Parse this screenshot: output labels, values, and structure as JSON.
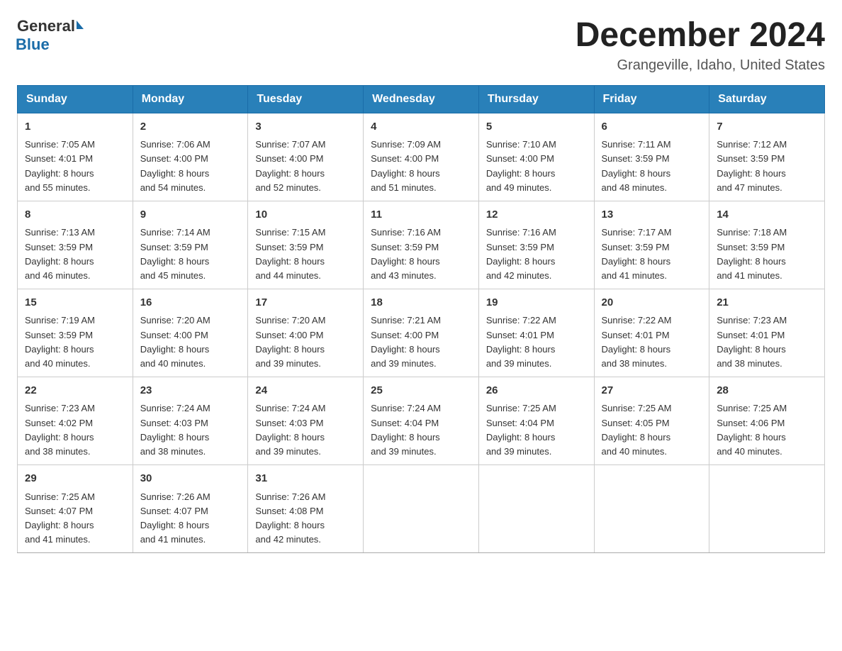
{
  "header": {
    "logo_general": "General",
    "logo_blue": "Blue",
    "month_title": "December 2024",
    "location": "Grangeville, Idaho, United States"
  },
  "days_of_week": [
    "Sunday",
    "Monday",
    "Tuesday",
    "Wednesday",
    "Thursday",
    "Friday",
    "Saturday"
  ],
  "weeks": [
    [
      {
        "day": "1",
        "sunrise": "7:05 AM",
        "sunset": "4:01 PM",
        "daylight": "8 hours and 55 minutes."
      },
      {
        "day": "2",
        "sunrise": "7:06 AM",
        "sunset": "4:00 PM",
        "daylight": "8 hours and 54 minutes."
      },
      {
        "day": "3",
        "sunrise": "7:07 AM",
        "sunset": "4:00 PM",
        "daylight": "8 hours and 52 minutes."
      },
      {
        "day": "4",
        "sunrise": "7:09 AM",
        "sunset": "4:00 PM",
        "daylight": "8 hours and 51 minutes."
      },
      {
        "day": "5",
        "sunrise": "7:10 AM",
        "sunset": "4:00 PM",
        "daylight": "8 hours and 49 minutes."
      },
      {
        "day": "6",
        "sunrise": "7:11 AM",
        "sunset": "3:59 PM",
        "daylight": "8 hours and 48 minutes."
      },
      {
        "day": "7",
        "sunrise": "7:12 AM",
        "sunset": "3:59 PM",
        "daylight": "8 hours and 47 minutes."
      }
    ],
    [
      {
        "day": "8",
        "sunrise": "7:13 AM",
        "sunset": "3:59 PM",
        "daylight": "8 hours and 46 minutes."
      },
      {
        "day": "9",
        "sunrise": "7:14 AM",
        "sunset": "3:59 PM",
        "daylight": "8 hours and 45 minutes."
      },
      {
        "day": "10",
        "sunrise": "7:15 AM",
        "sunset": "3:59 PM",
        "daylight": "8 hours and 44 minutes."
      },
      {
        "day": "11",
        "sunrise": "7:16 AM",
        "sunset": "3:59 PM",
        "daylight": "8 hours and 43 minutes."
      },
      {
        "day": "12",
        "sunrise": "7:16 AM",
        "sunset": "3:59 PM",
        "daylight": "8 hours and 42 minutes."
      },
      {
        "day": "13",
        "sunrise": "7:17 AM",
        "sunset": "3:59 PM",
        "daylight": "8 hours and 41 minutes."
      },
      {
        "day": "14",
        "sunrise": "7:18 AM",
        "sunset": "3:59 PM",
        "daylight": "8 hours and 41 minutes."
      }
    ],
    [
      {
        "day": "15",
        "sunrise": "7:19 AM",
        "sunset": "3:59 PM",
        "daylight": "8 hours and 40 minutes."
      },
      {
        "day": "16",
        "sunrise": "7:20 AM",
        "sunset": "4:00 PM",
        "daylight": "8 hours and 40 minutes."
      },
      {
        "day": "17",
        "sunrise": "7:20 AM",
        "sunset": "4:00 PM",
        "daylight": "8 hours and 39 minutes."
      },
      {
        "day": "18",
        "sunrise": "7:21 AM",
        "sunset": "4:00 PM",
        "daylight": "8 hours and 39 minutes."
      },
      {
        "day": "19",
        "sunrise": "7:22 AM",
        "sunset": "4:01 PM",
        "daylight": "8 hours and 39 minutes."
      },
      {
        "day": "20",
        "sunrise": "7:22 AM",
        "sunset": "4:01 PM",
        "daylight": "8 hours and 38 minutes."
      },
      {
        "day": "21",
        "sunrise": "7:23 AM",
        "sunset": "4:01 PM",
        "daylight": "8 hours and 38 minutes."
      }
    ],
    [
      {
        "day": "22",
        "sunrise": "7:23 AM",
        "sunset": "4:02 PM",
        "daylight": "8 hours and 38 minutes."
      },
      {
        "day": "23",
        "sunrise": "7:24 AM",
        "sunset": "4:03 PM",
        "daylight": "8 hours and 38 minutes."
      },
      {
        "day": "24",
        "sunrise": "7:24 AM",
        "sunset": "4:03 PM",
        "daylight": "8 hours and 39 minutes."
      },
      {
        "day": "25",
        "sunrise": "7:24 AM",
        "sunset": "4:04 PM",
        "daylight": "8 hours and 39 minutes."
      },
      {
        "day": "26",
        "sunrise": "7:25 AM",
        "sunset": "4:04 PM",
        "daylight": "8 hours and 39 minutes."
      },
      {
        "day": "27",
        "sunrise": "7:25 AM",
        "sunset": "4:05 PM",
        "daylight": "8 hours and 40 minutes."
      },
      {
        "day": "28",
        "sunrise": "7:25 AM",
        "sunset": "4:06 PM",
        "daylight": "8 hours and 40 minutes."
      }
    ],
    [
      {
        "day": "29",
        "sunrise": "7:25 AM",
        "sunset": "4:07 PM",
        "daylight": "8 hours and 41 minutes."
      },
      {
        "day": "30",
        "sunrise": "7:26 AM",
        "sunset": "4:07 PM",
        "daylight": "8 hours and 41 minutes."
      },
      {
        "day": "31",
        "sunrise": "7:26 AM",
        "sunset": "4:08 PM",
        "daylight": "8 hours and 42 minutes."
      },
      null,
      null,
      null,
      null
    ]
  ],
  "labels": {
    "sunrise": "Sunrise:",
    "sunset": "Sunset:",
    "daylight": "Daylight:"
  }
}
